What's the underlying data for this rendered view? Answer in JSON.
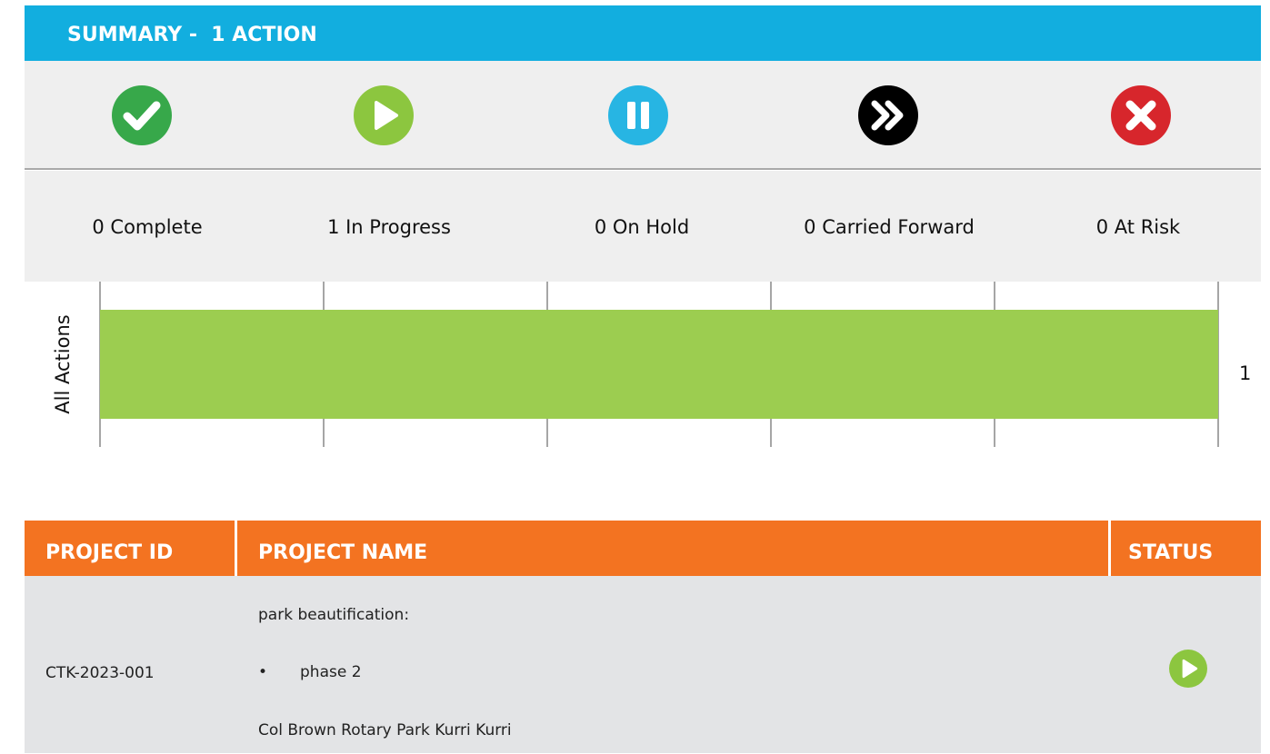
{
  "summary": {
    "title": "SUMMARY -  1 ACTION"
  },
  "statuses": [
    {
      "icon": "check-icon",
      "color": "#37a84a",
      "label": "0 Complete"
    },
    {
      "icon": "play-icon",
      "color": "#8cc63f",
      "label": "1 In Progress"
    },
    {
      "icon": "pause-icon",
      "color": "#27b5e3",
      "label": "0 On Hold"
    },
    {
      "icon": "fast-forward-icon",
      "color": "#000000",
      "label": "0 Carried Forward"
    },
    {
      "icon": "close-icon",
      "color": "#d7262c",
      "label": "0 At Risk"
    }
  ],
  "chart_data": {
    "type": "bar",
    "orientation": "horizontal",
    "categories": [
      "All Actions"
    ],
    "values": [
      1
    ],
    "data_labels": [
      "1"
    ],
    "bar_color": "#9ccd50",
    "xlim": [
      0,
      1
    ],
    "grid": true,
    "xlabel": "",
    "ylabel": ""
  },
  "table": {
    "headers": {
      "id": "PROJECT ID",
      "name": "PROJECT NAME",
      "status": "STATUS"
    },
    "rows": [
      {
        "id": "CTK-2023-001",
        "name_line1": "park beautification:",
        "bullet": "•",
        "name_bullet": "phase 2",
        "name_line3": "Col Brown Rotary Park Kurri Kurri",
        "status_icon": "play-icon"
      }
    ]
  },
  "colors": {
    "summary_header": "#12aedf",
    "table_header": "#f37321",
    "band_bg": "#efefef",
    "row_bg": "#e3e4e6"
  }
}
